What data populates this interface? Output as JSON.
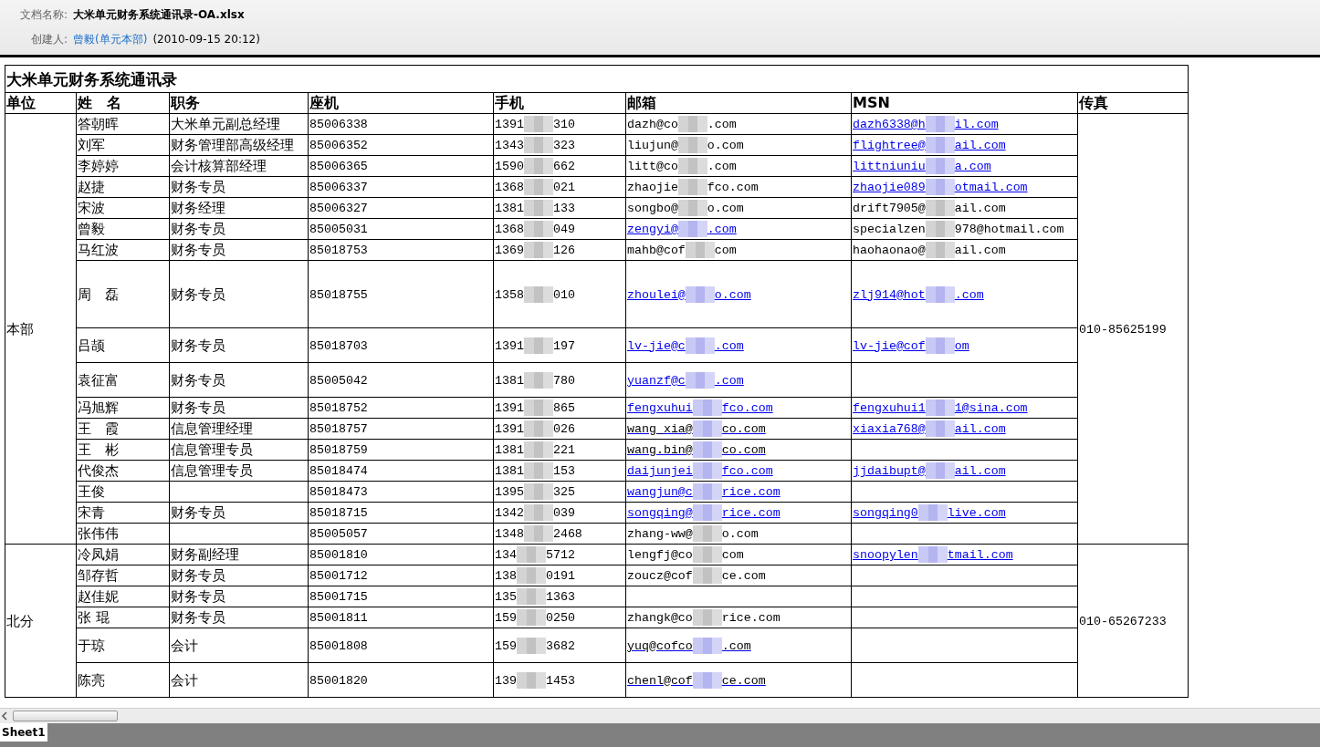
{
  "document": {
    "name_label": "文档名称:",
    "name": "大米单元财务系统通讯录-OA.xlsx",
    "creator_label": "创建人:",
    "creator": "曾毅(单元本部)",
    "created": "(2010-09-15 20:12)"
  },
  "sheet": {
    "title": "大米单元财务系统通讯录",
    "columns": [
      "单位",
      "姓　名",
      "职务",
      "座机",
      "手机",
      "邮箱",
      "MSN",
      "传真"
    ],
    "groups": [
      {
        "unit": "本部",
        "fax": "010-85625199",
        "rows": [
          {
            "name": "答朝晖",
            "title": "大米单元副总经理",
            "landline": "85006338",
            "mobile": [
              "1391",
              "310"
            ],
            "email": {
              "kind": "plain",
              "parts": [
                "dazh@co",
                ".com"
              ]
            },
            "msn": {
              "kind": "link",
              "parts": [
                "dazh6338@h",
                "il.com"
              ]
            }
          },
          {
            "name": "刘军",
            "title": "财务管理部高级经理",
            "landline": "85006352",
            "mobile": [
              "1343",
              "323"
            ],
            "email": {
              "kind": "plain",
              "parts": [
                "liujun@",
                "o.com"
              ]
            },
            "msn": {
              "kind": "link",
              "parts": [
                "flightree@",
                "ail.com"
              ]
            }
          },
          {
            "name": "李婷婷",
            "title": "会计核算部经理",
            "landline": "85006365",
            "mobile": [
              "1590",
              "662"
            ],
            "email": {
              "kind": "plain",
              "parts": [
                "litt@co",
                ".com"
              ]
            },
            "msn": {
              "kind": "link",
              "parts": [
                "littniuniu",
                "a.com"
              ]
            }
          },
          {
            "name": "赵捷",
            "title": "财务专员",
            "landline": "85006337",
            "mobile": [
              "1368",
              "021"
            ],
            "email": {
              "kind": "plain",
              "parts": [
                "zhaojie",
                "fco.com"
              ]
            },
            "msn": {
              "kind": "link",
              "parts": [
                "zhaojie089",
                "otmail.com"
              ]
            }
          },
          {
            "name": "宋波",
            "title": "财务经理",
            "landline": "85006327",
            "mobile": [
              "1381",
              "133"
            ],
            "email": {
              "kind": "plain",
              "parts": [
                "songbo@",
                "o.com"
              ]
            },
            "msn": {
              "kind": "plain",
              "parts": [
                "drift7905@",
                "ail.com"
              ]
            }
          },
          {
            "name": "曾毅",
            "title": "财务专员",
            "landline": "85005031",
            "mobile": [
              "1368",
              "049"
            ],
            "email": {
              "kind": "link",
              "parts": [
                "zengyi@",
                ".com"
              ]
            },
            "msn": {
              "kind": "plain",
              "parts": [
                "specialzen",
                "978@hotmail.com"
              ]
            }
          },
          {
            "name": "马红波",
            "title": "财务专员",
            "landline": "85018753",
            "mobile": [
              "1369",
              "126"
            ],
            "email": {
              "kind": "plain",
              "parts": [
                "mahb@cof",
                "com"
              ]
            },
            "msn": {
              "kind": "plain",
              "parts": [
                "haohaonao@",
                "ail.com"
              ]
            }
          },
          {
            "name": "周　磊",
            "title": "财务专员",
            "landline": "85018755",
            "mobile": [
              "1358",
              "010"
            ],
            "email": {
              "kind": "link",
              "parts": [
                "zhoulei@",
                "o.com"
              ]
            },
            "msn": {
              "kind": "link",
              "parts": [
                "zlj914@hot",
                ".com"
              ]
            }
          },
          {
            "name": "吕颉",
            "title": "财务专员",
            "landline": "85018703",
            "mobile": [
              "1391",
              "197"
            ],
            "email": {
              "kind": "link",
              "parts": [
                "lv-jie@c",
                ".com"
              ]
            },
            "msn": {
              "kind": "link",
              "parts": [
                "lv-jie@cof",
                "om"
              ]
            }
          },
          {
            "name": "袁征富",
            "title": "财务专员",
            "landline": "85005042",
            "mobile": [
              "1381",
              "780"
            ],
            "email": {
              "kind": "link",
              "parts": [
                "yuanzf@c",
                ".com"
              ]
            }
          },
          {
            "name": "冯旭辉",
            "title": "财务专员",
            "landline": "85018752",
            "mobile": [
              "1391",
              "865"
            ],
            "email": {
              "kind": "link",
              "parts": [
                "fengxuhui",
                "fco.com"
              ]
            },
            "msn": {
              "kind": "link",
              "parts": [
                "fengxuhui1",
                "1@sina.com"
              ]
            }
          },
          {
            "name": "王　霞",
            "title": "信息管理经理",
            "landline": "85018757",
            "mobile": [
              "1391",
              "026"
            ],
            "email": {
              "kind": "visited",
              "parts": [
                "wang_xia@",
                "co.com"
              ]
            },
            "msn": {
              "kind": "link",
              "parts": [
                "xiaxia768@",
                "ail.com"
              ]
            }
          },
          {
            "name": "王　彬",
            "title": "信息管理专员",
            "landline": "85018759",
            "mobile": [
              "1381",
              "221"
            ],
            "email": {
              "kind": "visited",
              "parts": [
                "wang.bin@",
                "co.com"
              ]
            }
          },
          {
            "name": "代俊杰",
            "title": "信息管理专员",
            "landline": "85018474",
            "mobile": [
              "1381",
              "153"
            ],
            "email": {
              "kind": "link",
              "parts": [
                "daijunjei",
                "fco.com"
              ]
            },
            "msn": {
              "kind": "link",
              "parts": [
                "jjdaibupt@",
                "ail.com"
              ]
            }
          },
          {
            "name": "王俊",
            "landline": "85018473",
            "mobile": [
              "1395",
              "325"
            ],
            "email": {
              "kind": "link",
              "parts": [
                "wangjun@c",
                "rice.com"
              ]
            }
          },
          {
            "name": "宋青",
            "title": "财务专员",
            "landline": "85018715",
            "mobile": [
              "1342",
              "039"
            ],
            "email": {
              "kind": "link",
              "parts": [
                "songqing@",
                "rice.com"
              ]
            },
            "msn": {
              "kind": "link",
              "parts": [
                "songqing0",
                "live.com"
              ]
            }
          },
          {
            "name": "张伟伟",
            "landline": "85005057",
            "mobile": [
              "1348",
              "2468"
            ],
            "email": {
              "kind": "plain",
              "parts": [
                "zhang-ww@",
                "o.com"
              ]
            }
          }
        ]
      },
      {
        "unit": "北分",
        "fax": "010-65267233",
        "rows": [
          {
            "name": "冷凤娟",
            "title": "财务副经理",
            "landline": "85001810",
            "mobile": [
              "134",
              "5712"
            ],
            "email": {
              "kind": "plain",
              "parts": [
                "lengfj@co",
                "com"
              ]
            },
            "msn": {
              "kind": "link",
              "parts": [
                "snoopylen",
                "tmail.com"
              ]
            }
          },
          {
            "name": "邹存哲",
            "title": "财务专员",
            "landline": "85001712",
            "mobile": [
              "138",
              "0191"
            ],
            "email": {
              "kind": "plain",
              "parts": [
                "zoucz@cof",
                "ce.com"
              ]
            }
          },
          {
            "name": "赵佳妮",
            "title": "财务专员",
            "landline": "85001715",
            "mobile": [
              "135",
              "1363"
            ]
          },
          {
            "name": "张 琨",
            "title": "财务专员",
            "landline": "85001811",
            "mobile": [
              "159",
              "0250"
            ],
            "email": {
              "kind": "plain",
              "parts": [
                "zhangk@co",
                "rice.com"
              ]
            }
          },
          {
            "name": "于琼",
            "title": "会计",
            "landline": "85001808",
            "mobile": [
              "159",
              "3682"
            ],
            "email": {
              "kind": "visited",
              "parts": [
                "yuq@cofco",
                ".com"
              ]
            }
          },
          {
            "name": "陈亮",
            "title": "会计",
            "landline": "85001820",
            "mobile": [
              "139",
              "1453"
            ],
            "email": {
              "kind": "visited",
              "parts": [
                "chenl@cof",
                "ce.com"
              ]
            }
          }
        ]
      }
    ]
  },
  "sheet_tabs": [
    {
      "label": "Sheet1",
      "selected": true
    }
  ]
}
